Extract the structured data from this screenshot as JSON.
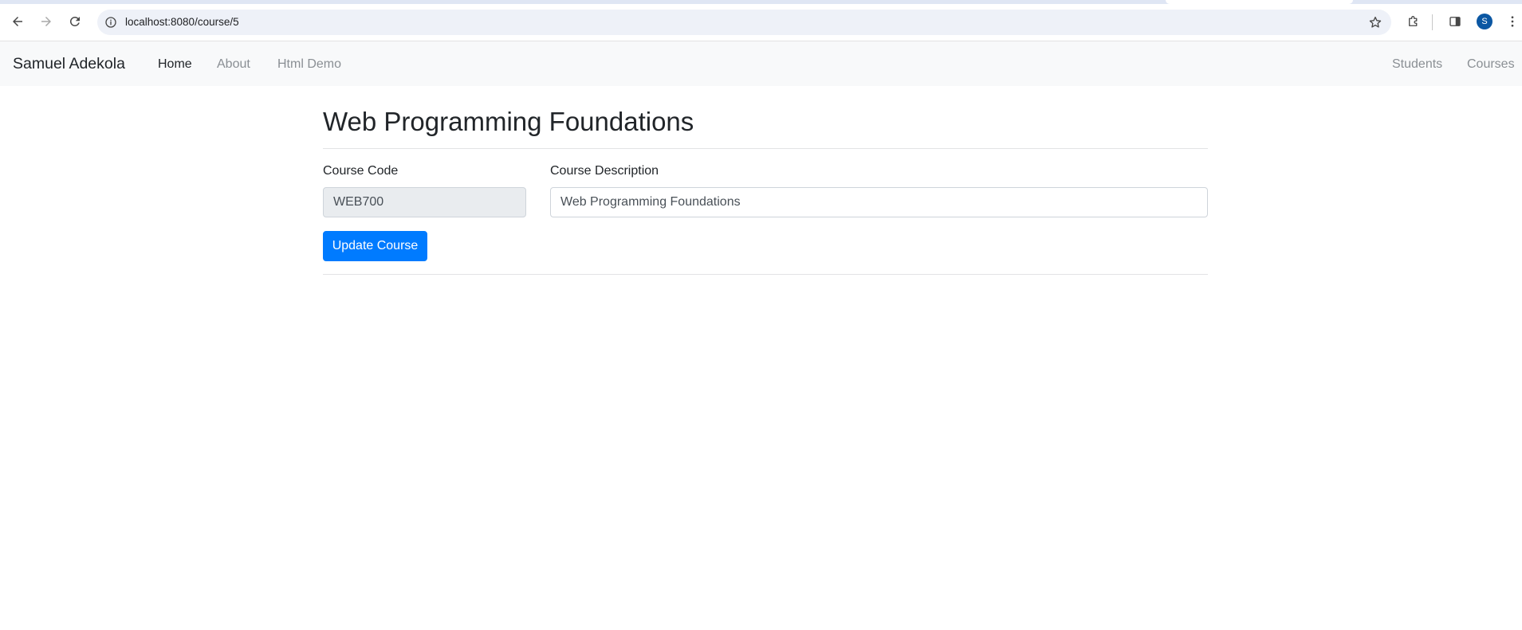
{
  "browser": {
    "url": "localhost:8080/course/5",
    "profile_initial": "S"
  },
  "navbar": {
    "brand": "Samuel Adekola",
    "left_links": [
      {
        "label": "Home",
        "active": true
      },
      {
        "label": "About",
        "active": false
      },
      {
        "label": "Html Demo",
        "active": false
      }
    ],
    "right_links": [
      {
        "label": "Students"
      },
      {
        "label": "Courses"
      }
    ]
  },
  "page": {
    "title": "Web Programming Foundations"
  },
  "form": {
    "course_code_label": "Course Code",
    "course_code_value": "WEB700",
    "course_description_label": "Course Description",
    "course_description_value": "Web Programming Foundations",
    "submit_label": "Update Course"
  },
  "colors": {
    "primary": "#007bff",
    "navbar_bg": "#f8f9fa",
    "avatar_bg": "#0b57a3"
  },
  "icons": {
    "back": "arrow-left-icon",
    "forward": "arrow-right-icon",
    "reload": "reload-icon",
    "site_info": "info-icon",
    "bookmark": "star-icon",
    "extensions": "puzzle-icon",
    "side_panel": "side-panel-icon",
    "menu": "kebab-menu-icon"
  }
}
